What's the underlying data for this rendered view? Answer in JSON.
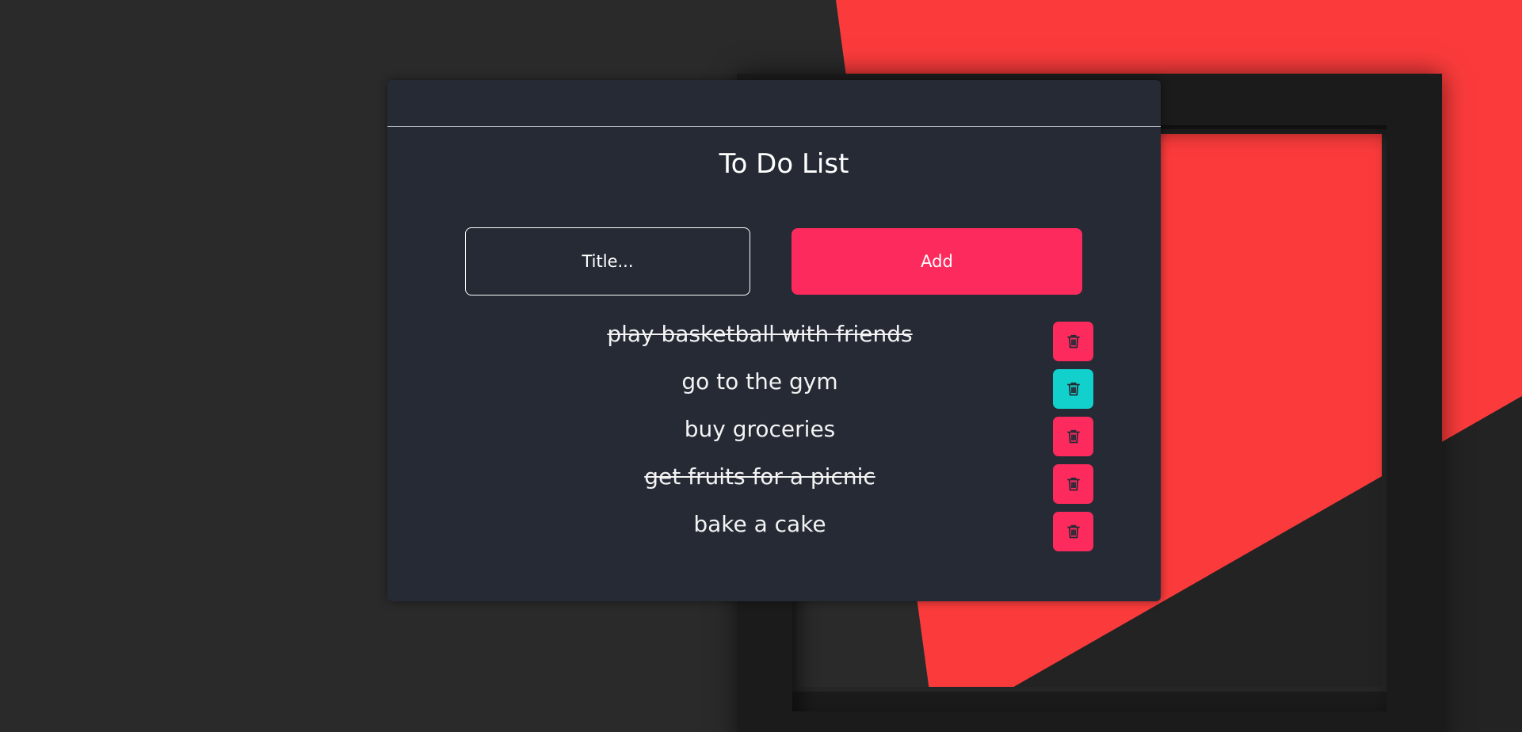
{
  "app": {
    "title": "To Do List"
  },
  "form": {
    "input_placeholder": "Title...",
    "input_value": "",
    "add_label": "Add"
  },
  "todos": [
    {
      "text": "play basketball with friends",
      "completed": true,
      "delete_highlighted": false
    },
    {
      "text": "go to the gym",
      "completed": false,
      "delete_highlighted": true
    },
    {
      "text": "buy groceries",
      "completed": false,
      "delete_highlighted": false
    },
    {
      "text": "get fruits for a picnic",
      "completed": true,
      "delete_highlighted": false
    },
    {
      "text": "bake a cake",
      "completed": false,
      "delete_highlighted": false
    }
  ],
  "icons": {
    "delete": "trash-icon"
  },
  "colors": {
    "card_bg": "#252a35",
    "accent": "#fd2a5e",
    "highlight": "#12d0cc",
    "text": "#ffffff",
    "background_red": "#fb3b3b",
    "background_dark": "#2a2a2b"
  }
}
